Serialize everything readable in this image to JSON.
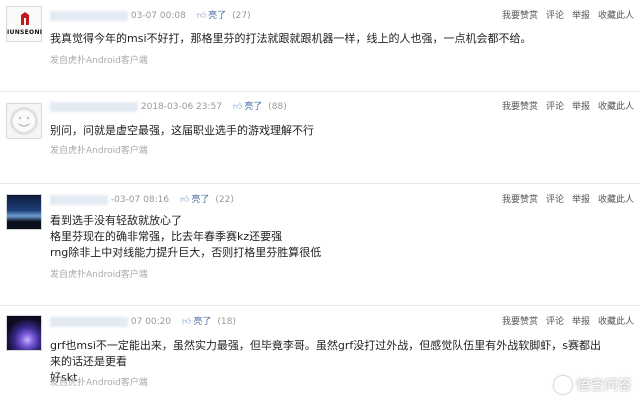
{
  "comments": [
    {
      "date": "03-07 00:08",
      "like_label": "亮了",
      "like_count": "(27)",
      "avatar_text": "IUNSEONI",
      "actions": [
        "我要赞赏",
        "评论",
        "举报",
        "收藏此人"
      ],
      "lines": [
        "我真觉得今年的msi不好打，那格里芬的打法就跟就跟机器一样，线上的人也强，一点机会都不给。"
      ],
      "source": "发自虎扑Android客户端"
    },
    {
      "date": "2018-03-06 23:57",
      "like_label": "亮了",
      "like_count": "(88)",
      "actions": [
        "我要赞赏",
        "评论",
        "举报",
        "收藏此人"
      ],
      "lines": [
        "别问，问就是虚空最强，这届职业选手的游戏理解不行"
      ],
      "source": "发自虎扑Android客户端"
    },
    {
      "date": "-03-07 08:16",
      "like_label": "亮了",
      "like_count": "(22)",
      "actions": [
        "我要赞赏",
        "评论",
        "举报",
        "收藏此人"
      ],
      "lines": [
        "看到选手没有轻敌就放心了",
        "格里芬现在的确非常强，比去年春季赛kz还要强",
        "rng除非上中对线能力提升巨大，否则打格里芬胜算很低"
      ],
      "source": "发自虎扑Android客户端"
    },
    {
      "date": "07 00:20",
      "like_label": "亮了",
      "like_count": "(18)",
      "actions": [
        "我要赞赏",
        "评论",
        "举报",
        "收藏此人"
      ],
      "lines": [
        "grf也msi不一定能出来，虽然实力最强，但毕竟李哥。虽然grf没打过外战，但感觉队伍里有外战软脚虾，s赛都出来的话还是更看",
        "好skt"
      ],
      "source": "发自虎扑Android客户端"
    }
  ],
  "watermark": "悟空问答"
}
